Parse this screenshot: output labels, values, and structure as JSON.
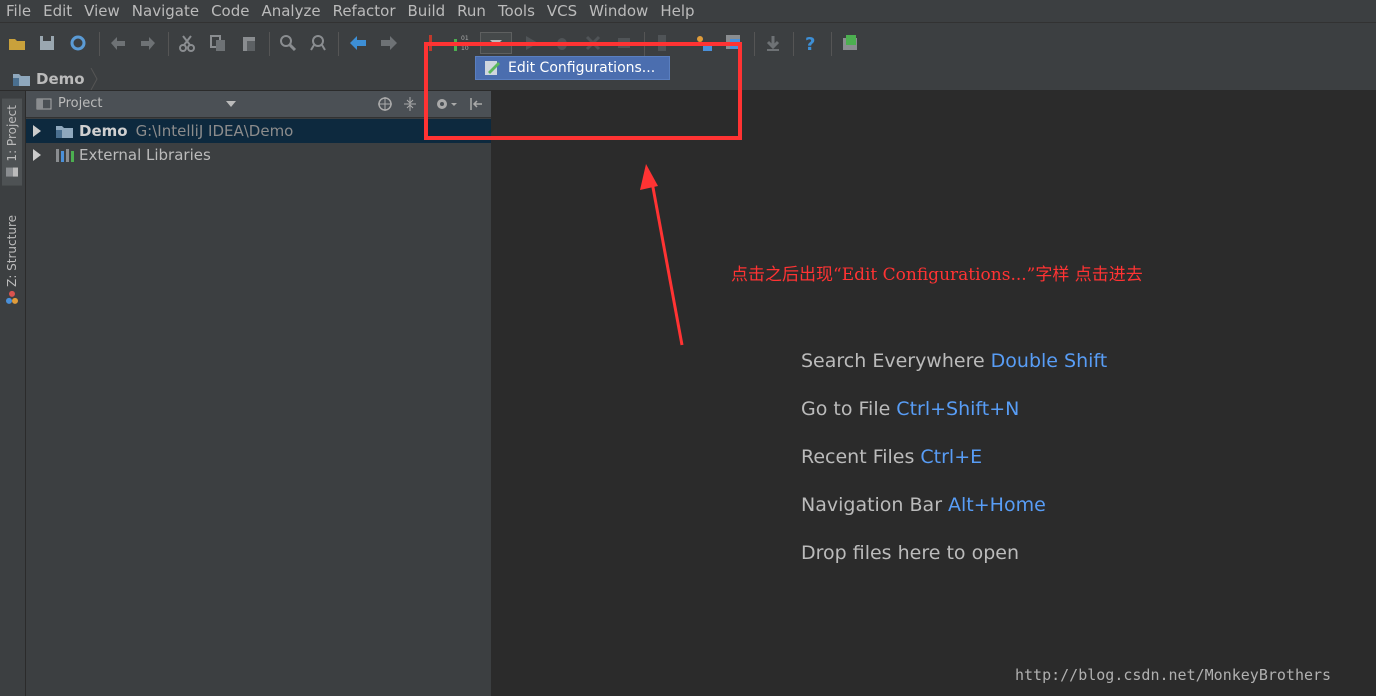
{
  "menu": [
    "File",
    "Edit",
    "View",
    "Navigate",
    "Code",
    "Analyze",
    "Refactor",
    "Build",
    "Run",
    "Tools",
    "VCS",
    "Window",
    "Help"
  ],
  "navbar": {
    "breadcrumb": "Demo"
  },
  "left_strip": {
    "tab_project": "1: Project",
    "tab_structure": "Z: Structure"
  },
  "project_panel": {
    "title": "Project",
    "tree": [
      {
        "name": "Demo",
        "path": "G:\\IntelliJ IDEA\\Demo",
        "selected": true
      },
      {
        "name": "External Libraries",
        "path": "",
        "selected": false
      }
    ]
  },
  "popup": {
    "label": "Edit Configurations..."
  },
  "annotation": "点击之后出现“Edit Configurations...”字样 点击进去",
  "editor_hints": [
    {
      "text": "Search Everywhere",
      "key": "Double Shift"
    },
    {
      "text": "Go to File",
      "key": "Ctrl+Shift+N"
    },
    {
      "text": "Recent Files",
      "key": "Ctrl+E"
    },
    {
      "text": "Navigation Bar",
      "key": "Alt+Home"
    },
    {
      "text": "Drop files here to open",
      "key": ""
    }
  ],
  "watermark": "http://blog.csdn.net/MonkeyBrothers",
  "colors": {
    "accent": "#589df6",
    "annotation_red": "#ff3333",
    "selection": "#0d293e",
    "popup": "#4b6eaf"
  }
}
